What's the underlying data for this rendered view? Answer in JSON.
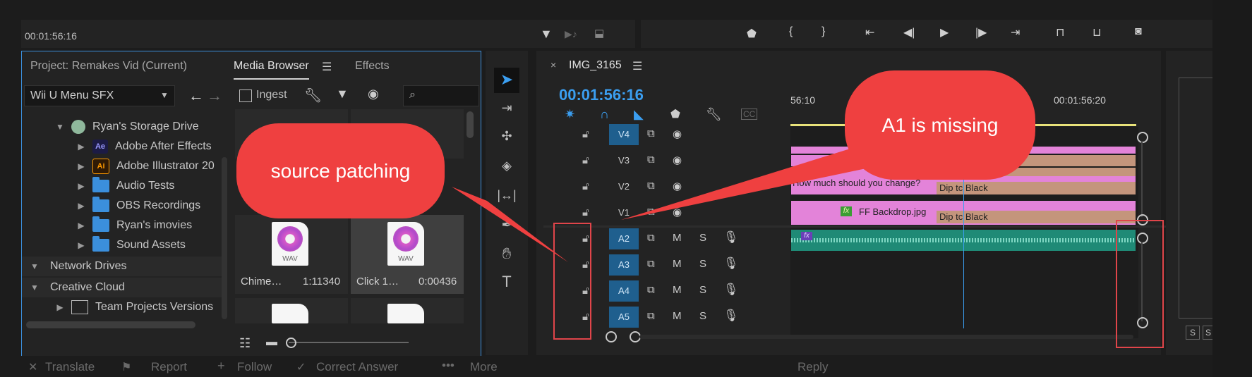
{
  "top_bar": {
    "timecode": "00:01:56:16"
  },
  "project_panel": {
    "tabs": [
      "Project: Remakes Vid (Current)",
      "Media Browser",
      "Effects"
    ],
    "dropdown_value": "Wii U Menu SFX",
    "ingest_label": "Ingest",
    "tree": [
      {
        "label": "Ryan's Storage Drive"
      },
      {
        "label": "Adobe After Effects"
      },
      {
        "label": "Adobe Illustrator 20"
      },
      {
        "label": "Audio Tests"
      },
      {
        "label": "OBS Recordings"
      },
      {
        "label": "Ryan's imovies"
      },
      {
        "label": "Sound Assets"
      },
      {
        "label": "Network Drives"
      },
      {
        "label": "Creative Cloud"
      },
      {
        "label": "Team Projects Versions"
      }
    ],
    "thumbs": [
      {
        "name": "Chime…",
        "duration": "1:11340",
        "type": "WAV"
      },
      {
        "name": "Click 1…",
        "duration": "0:00436",
        "type": "WAV"
      }
    ],
    "app_badges": {
      "ae": "Ae",
      "ai": "Ai"
    }
  },
  "timeline": {
    "tab_label": "IMG_3165",
    "timecode": "00:01:56:16",
    "ruler": [
      "56:10",
      "00:01:56:20"
    ],
    "tracks": [
      "V4",
      "V3",
      "V2",
      "V1",
      "A2",
      "A3",
      "A4",
      "A5"
    ],
    "audio_buttons": [
      "M",
      "S"
    ],
    "clips": {
      "v2_title": "How much should you change?",
      "v1_image": "FF Backdrop.jpg",
      "transition1": "Dip tc Black",
      "transition2": "Dip tc Black",
      "fx": "fx"
    }
  },
  "right_panel": {
    "buttons": [
      "S",
      "S"
    ]
  },
  "bottom_bar": {
    "items": [
      "Translate",
      "Report",
      "Follow",
      "Correct Answer",
      "More",
      "Reply"
    ]
  },
  "annotations": {
    "source_patching": "source patching",
    "a1_missing": "A1 is missing"
  },
  "colors": {
    "accent": "#3b9ef0",
    "clip_pink": "#e383d9",
    "clip_tan": "#c4957c",
    "audio_green": "#1f8a76",
    "annotation_red": "#ef4040"
  }
}
